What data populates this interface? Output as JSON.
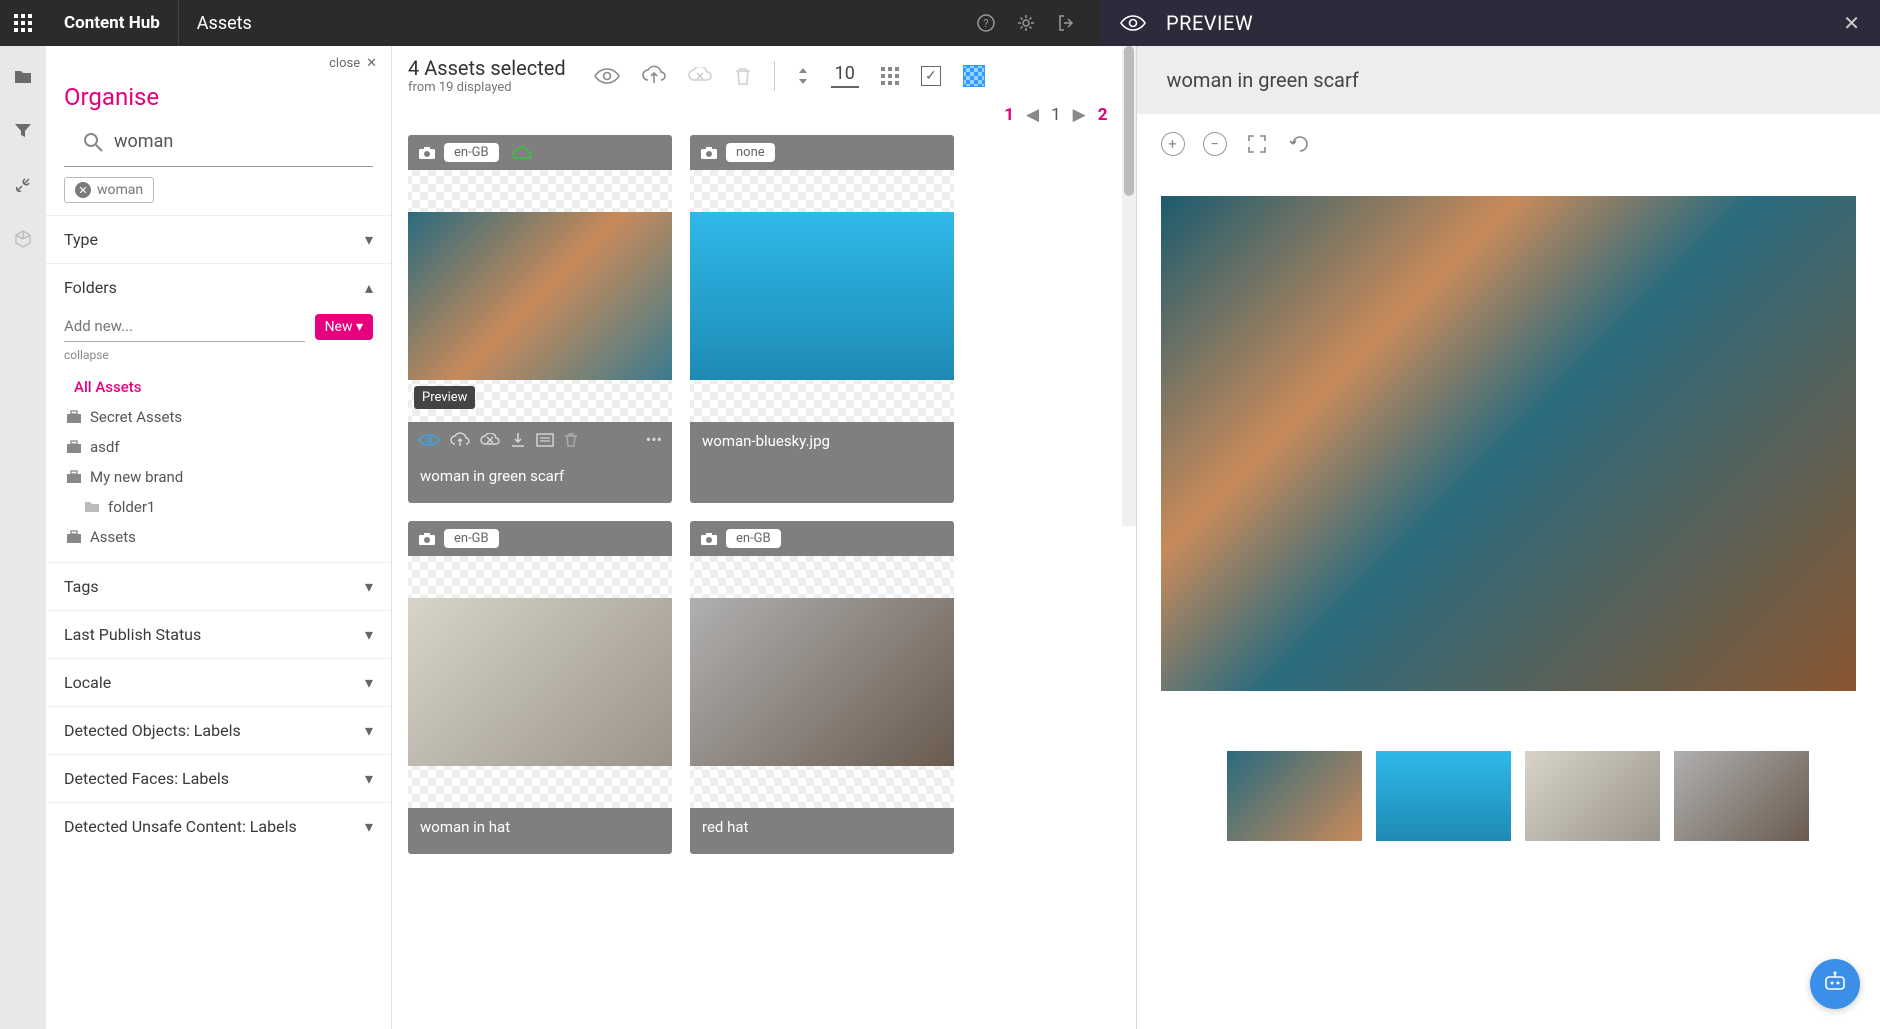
{
  "brand": "Content Hub",
  "pageTitle": "Assets",
  "sidebar": {
    "closeLabel": "close",
    "title": "Organise",
    "searchValue": "woman",
    "chip": "woman",
    "filters": {
      "type": "Type",
      "folders": "Folders",
      "addNewPlaceholder": "Add new...",
      "newBtn": "New ▾",
      "collapse": "collapse",
      "folderItems": [
        {
          "label": "All Assets",
          "active": true,
          "icon": "none"
        },
        {
          "label": "Secret Assets",
          "icon": "briefcase"
        },
        {
          "label": "asdf",
          "icon": "briefcase"
        },
        {
          "label": "My new brand",
          "icon": "briefcase"
        },
        {
          "label": "folder1",
          "icon": "folder",
          "indent": true
        },
        {
          "label": "Assets",
          "icon": "briefcase"
        }
      ],
      "tags": "Tags",
      "lastPublish": "Last Publish Status",
      "locale": "Locale",
      "detectedObjects": "Detected Objects: Labels",
      "detectedFaces": "Detected Faces: Labels",
      "detectedUnsafe": "Detected Unsafe Content: Labels"
    }
  },
  "toolbar": {
    "selectedText": "4 Assets selected",
    "fromText": "from 19 displayed",
    "count": "10"
  },
  "pagination": {
    "page1": "1",
    "current": "1",
    "page2": "2"
  },
  "assets": [
    {
      "locale": "en-GB",
      "label": "woman in green scarf",
      "cloud": true,
      "thumb": "t1",
      "actions": true,
      "tooltip": "Preview"
    },
    {
      "locale": "none",
      "label": "woman-bluesky.jpg",
      "thumb": "t2"
    },
    {
      "locale": "en-GB",
      "label": "woman in hat",
      "thumb": "t3"
    },
    {
      "locale": "en-GB",
      "label": "red hat",
      "thumb": "t4"
    }
  ],
  "preview": {
    "title": "PREVIEW",
    "assetTitle": "woman in green scarf"
  }
}
